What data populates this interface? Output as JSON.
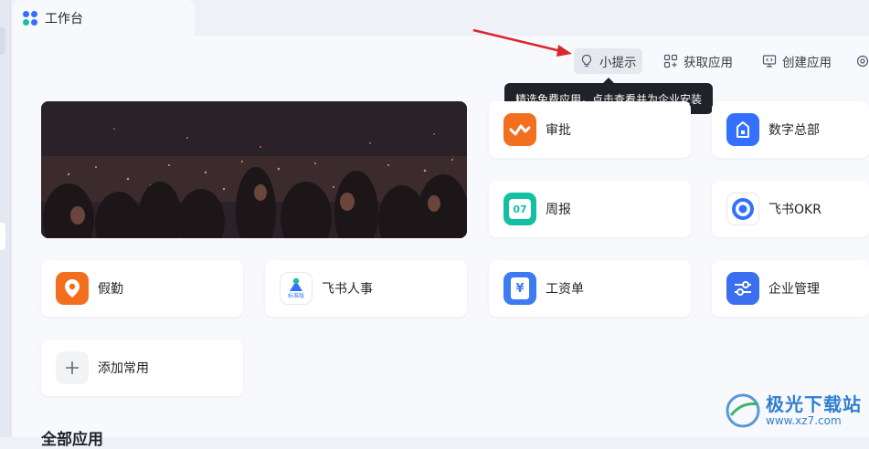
{
  "tab": {
    "title": "工作台"
  },
  "toolbar": {
    "tips_label": "小提示",
    "get_apps_label": "获取应用",
    "create_app_label": "创建应用"
  },
  "tooltip": {
    "text": "精选免费应用，点击查看并为企业安装"
  },
  "apps": {
    "approval": "审批",
    "digital_hq": "数字总部",
    "weekly": "周报",
    "weekly_icon_text": "07",
    "okr": "飞书OKR",
    "leave": "假勤",
    "hr": "飞书人事",
    "hr_badge": "标准版",
    "payroll": "工资单",
    "payroll_icon_text": "¥",
    "enterprise_mgmt": "企业管理",
    "add_common": "添加常用"
  },
  "section": {
    "all_apps_title": "全部应用"
  },
  "watermark": {
    "brand": "极光下载站",
    "url": "www.xz7.com"
  },
  "colors": {
    "approval": "#f26f20",
    "digital_hq": "#3370ff",
    "weekly": "#14c0a3",
    "okr": "#3370ff",
    "leave": "#f26f20",
    "payroll": "#3c7bf1",
    "enterprise_mgmt": "#3c6ef0",
    "tooltip_bg": "#1f2329",
    "arrow": "#d9272e"
  }
}
